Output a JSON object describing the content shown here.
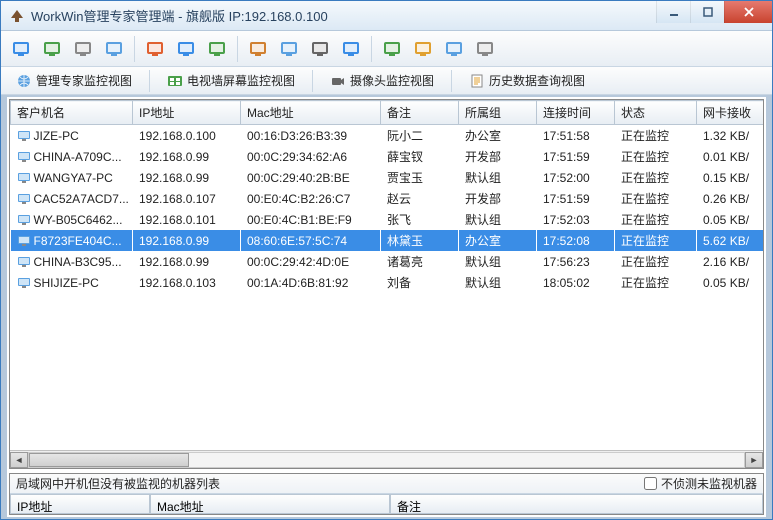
{
  "window": {
    "title": "WorkWin管理专家管理端 - 旗舰版 IP:192.168.0.100"
  },
  "tabs": {
    "t1": "管理专家监控视图",
    "t2": "电视墙屏幕监控视图",
    "t3": "摄像头监控视图",
    "t4": "历史数据查询视图"
  },
  "columns": {
    "c0": "客户机名",
    "c1": "IP地址",
    "c2": "Mac地址",
    "c3": "备注",
    "c4": "所属组",
    "c5": "连接时间",
    "c6": "状态",
    "c7": "网卡接收"
  },
  "rows": [
    {
      "name": "JIZE-PC",
      "ip": "192.168.0.100",
      "mac": "00:16:D3:26:B3:39",
      "note": "阮小二",
      "group": "办公室",
      "time": "17:51:58",
      "status": "正在监控",
      "nic": "1.32 KB/",
      "sel": false
    },
    {
      "name": "CHINA-A709C...",
      "ip": "192.168.0.99",
      "mac": "00:0C:29:34:62:A6",
      "note": "薛宝钗",
      "group": "开发部",
      "time": "17:51:59",
      "status": "正在监控",
      "nic": "0.01 KB/",
      "sel": false
    },
    {
      "name": "WANGYA7-PC",
      "ip": "192.168.0.99",
      "mac": "00:0C:29:40:2B:BE",
      "note": "贾宝玉",
      "group": "默认组",
      "time": "17:52:00",
      "status": "正在监控",
      "nic": "0.15 KB/",
      "sel": false
    },
    {
      "name": "CAC52A7ACD7...",
      "ip": "192.168.0.107",
      "mac": "00:E0:4C:B2:26:C7",
      "note": "赵云",
      "group": "开发部",
      "time": "17:51:59",
      "status": "正在监控",
      "nic": "0.26 KB/",
      "sel": false
    },
    {
      "name": "WY-B05C6462...",
      "ip": "192.168.0.101",
      "mac": "00:E0:4C:B1:BE:F9",
      "note": "张飞",
      "group": "默认组",
      "time": "17:52:03",
      "status": "正在监控",
      "nic": "0.05 KB/",
      "sel": false
    },
    {
      "name": "F8723FE404C...",
      "ip": "192.168.0.99",
      "mac": "08:60:6E:57:5C:74",
      "note": "林黛玉",
      "group": "办公室",
      "time": "17:52:08",
      "status": "正在监控",
      "nic": "5.62 KB/",
      "sel": true
    },
    {
      "name": "CHINA-B3C95...",
      "ip": "192.168.0.99",
      "mac": "00:0C:29:42:4D:0E",
      "note": "诸葛亮",
      "group": "默认组",
      "time": "17:56:23",
      "status": "正在监控",
      "nic": "2.16 KB/",
      "sel": false
    },
    {
      "name": "SHIJIZE-PC",
      "ip": "192.168.0.103",
      "mac": "00:1A:4D:6B:81:92",
      "note": "刘备",
      "group": "默认组",
      "time": "18:05:02",
      "status": "正在监控",
      "nic": "0.05 KB/",
      "sel": false
    }
  ],
  "bottom": {
    "title": "局域网中开机但没有被监视的机器列表",
    "checkbox": "不侦测未监视机器",
    "cols": {
      "ip": "IP地址",
      "mac": "Mac地址",
      "note": "备注"
    }
  },
  "toolbar_icons": [
    "connect-icon",
    "computer-icon",
    "settings-icon",
    "chat-icon",
    "screenshot-icon",
    "video-icon",
    "wall-icon",
    "lock-icon",
    "forward-icon",
    "camera-icon",
    "monitor-icon",
    "refresh-icon",
    "users-icon",
    "user-icon",
    "log-icon"
  ]
}
